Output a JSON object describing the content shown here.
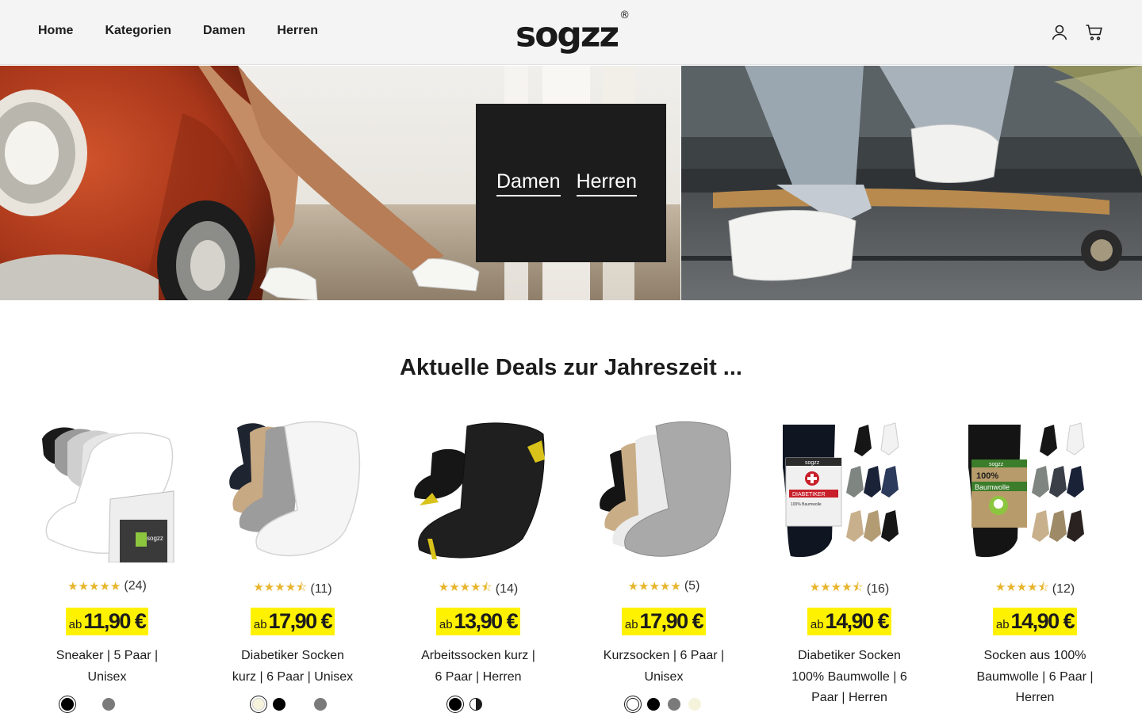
{
  "header": {
    "nav": [
      "Home",
      "Kategorien",
      "Damen",
      "Herren"
    ],
    "logo": "sogzz",
    "logo_mark": "®",
    "icons": [
      "account-icon",
      "cart-icon"
    ]
  },
  "hero": {
    "links": [
      "Damen",
      "Herren"
    ]
  },
  "section": {
    "title": "Aktuelle Deals zur Jahreszeit ..."
  },
  "products": [
    {
      "rating": "★★★★★",
      "reviews": "(24)",
      "price_prefix": "ab",
      "price": "11,90 €",
      "name": "Sneaker | 5 Paar | Unisex",
      "swatches": [
        "#000000",
        "#7a7a7a"
      ]
    },
    {
      "rating": "★★★★⯪",
      "reviews": "(11)",
      "price_prefix": "ab",
      "price": "17,90 €",
      "name": "Diabetiker Socken kurz | 6 Paar | Unisex",
      "swatches": [
        "#f6f3dc",
        "#000000",
        "#7a7a7a"
      ]
    },
    {
      "rating": "★★★★⯪",
      "reviews": "(14)",
      "price_prefix": "ab",
      "price": "13,90 €",
      "name": "Arbeitssocken kurz | 6 Paar | Herren",
      "swatches": [
        "#000000",
        "#3c3c3c"
      ]
    },
    {
      "rating": "★★★★★",
      "reviews": "(5)",
      "price_prefix": "ab",
      "price": "17,90 €",
      "name": "Kurzsocken | 6 Paar | Unisex",
      "swatches": [
        "#ffffff",
        "#000000",
        "#7a7a7a",
        "#f6f3dc"
      ]
    },
    {
      "rating": "★★★★⯪",
      "reviews": "(16)",
      "price_prefix": "ab",
      "price": "14,90 €",
      "name": "Diabetiker Socken 100% Baumwolle | 6 Paar | Herren",
      "swatches": []
    },
    {
      "rating": "★★★★⯪",
      "reviews": "(12)",
      "price_prefix": "ab",
      "price": "14,90 €",
      "name": "Socken aus 100% Baumwolle | 6 Paar | Herren",
      "swatches": []
    }
  ],
  "colors": {
    "price_highlight": "#fff200",
    "star": "#e7b52c",
    "hero_box": "#1c1c1c"
  }
}
